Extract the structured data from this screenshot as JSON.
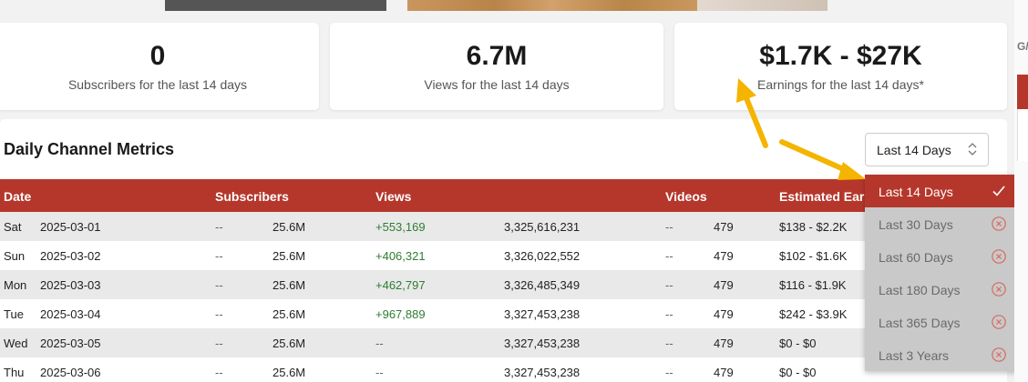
{
  "stats": {
    "subscribers_value": "0",
    "subscribers_label": "Subscribers for the last 14 days",
    "views_value": "6.7M",
    "views_label": "Views for the last 14 days",
    "earnings_value": "$1.7K - $27K",
    "earnings_label": "Earnings for the last 14 days*"
  },
  "metrics": {
    "title": "Daily Channel Metrics",
    "range_selected": "Last 14 Days",
    "columns": {
      "date": "Date",
      "subscribers": "Subscribers",
      "views": "Views",
      "videos": "Videos",
      "earnings": "Estimated Ear"
    },
    "rows": [
      {
        "day": "Sat",
        "date": "2025-03-01",
        "sub_change": "--",
        "subs": "25.6M",
        "view_change": "+553,169",
        "views": "3,325,616,231",
        "vid_change": "--",
        "videos": "479",
        "earnings": "$138 - $2.2K"
      },
      {
        "day": "Sun",
        "date": "2025-03-02",
        "sub_change": "--",
        "subs": "25.6M",
        "view_change": "+406,321",
        "views": "3,326,022,552",
        "vid_change": "--",
        "videos": "479",
        "earnings": "$102 - $1.6K"
      },
      {
        "day": "Mon",
        "date": "2025-03-03",
        "sub_change": "--",
        "subs": "25.6M",
        "view_change": "+462,797",
        "views": "3,326,485,349",
        "vid_change": "--",
        "videos": "479",
        "earnings": "$116 - $1.9K"
      },
      {
        "day": "Tue",
        "date": "2025-03-04",
        "sub_change": "--",
        "subs": "25.6M",
        "view_change": "+967,889",
        "views": "3,327,453,238",
        "vid_change": "--",
        "videos": "479",
        "earnings": "$242 - $3.9K"
      },
      {
        "day": "Wed",
        "date": "2025-03-05",
        "sub_change": "--",
        "subs": "25.6M",
        "view_change": "--",
        "views": "3,327,453,238",
        "vid_change": "--",
        "videos": "479",
        "earnings": "$0 - $0"
      },
      {
        "day": "Thu",
        "date": "2025-03-06",
        "sub_change": "--",
        "subs": "25.6M",
        "view_change": "--",
        "views": "3,327,453,238",
        "vid_change": "--",
        "videos": "479",
        "earnings": "$0 - $0"
      }
    ]
  },
  "dropdown": {
    "options": [
      {
        "label": "Last 14 Days",
        "selected": true,
        "icon": "check-icon"
      },
      {
        "label": "Last 30 Days",
        "selected": false,
        "icon": "circle-x-icon"
      },
      {
        "label": "Last 60 Days",
        "selected": false,
        "icon": "circle-x-icon"
      },
      {
        "label": "Last 180 Days",
        "selected": false,
        "icon": "circle-x-icon"
      },
      {
        "label": "Last 365 Days",
        "selected": false,
        "icon": "circle-x-icon"
      },
      {
        "label": "Last 3 Years",
        "selected": false,
        "icon": "circle-x-icon"
      }
    ]
  },
  "sidebar": {
    "cut_label": "G/"
  },
  "colors": {
    "accent": "#b5372c",
    "positive": "#2e7d32",
    "annotation_arrow": "#f4b400"
  }
}
